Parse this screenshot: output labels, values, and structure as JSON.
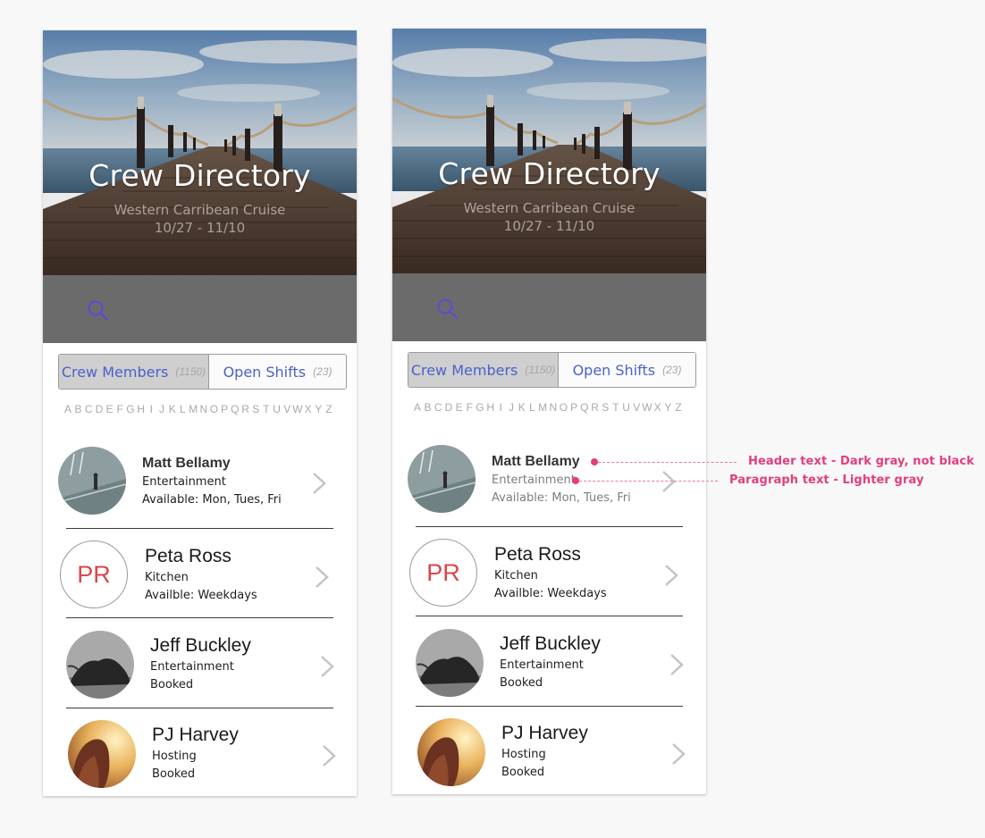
{
  "screens": [
    {
      "hero": {
        "title": "Crew Directory",
        "subtitle": "Western Carribean Cruise",
        "dates": "10/27 - 11/10"
      },
      "tabs": [
        {
          "label": "Crew Members",
          "count": "(1150)"
        },
        {
          "label": "Open Shifts",
          "count": "(23)"
        }
      ],
      "alphabet": [
        "A",
        "B",
        "C",
        "D",
        "E",
        "F",
        "G",
        "H",
        "I",
        "J",
        "K",
        "L",
        "M",
        "N",
        "O",
        "P",
        "Q",
        "R",
        "S",
        "T",
        "U",
        "V",
        "W",
        "X",
        "Y",
        "Z"
      ],
      "crew": [
        {
          "name": "Matt Bellamy",
          "role": "Entertainment",
          "availability": "Available: Mon, Tues, Fri",
          "avatar": "photo-platform"
        },
        {
          "name": "Peta Ross",
          "role": "Kitchen",
          "availability": "Availble: Weekdays",
          "initials": "PR"
        },
        {
          "name": "Jeff Buckley",
          "role": "Entertainment",
          "availability": "Booked",
          "avatar": "photo-hair-bw"
        },
        {
          "name": "PJ Harvey",
          "role": "Hosting",
          "availability": "Booked",
          "avatar": "photo-field-sunset"
        }
      ]
    },
    {
      "hero": {
        "title": "Crew Directory",
        "subtitle": "Western Carribean Cruise",
        "dates": "10/27 - 11/10"
      },
      "tabs": [
        {
          "label": "Crew Members",
          "count": "(1150)"
        },
        {
          "label": "Open Shifts",
          "count": "(23)"
        }
      ],
      "alphabet": [
        "A",
        "B",
        "C",
        "D",
        "E",
        "F",
        "G",
        "H",
        "I",
        "J",
        "K",
        "L",
        "M",
        "N",
        "O",
        "P",
        "Q",
        "R",
        "S",
        "T",
        "U",
        "V",
        "W",
        "X",
        "Y",
        "Z"
      ],
      "crew": [
        {
          "name": "Matt Bellamy",
          "role": "Entertainment",
          "availability": "Available: Mon, Tues, Fri",
          "avatar": "photo-platform"
        },
        {
          "name": "Peta Ross",
          "role": "Kitchen",
          "availability": "Availble: Weekdays",
          "initials": "PR"
        },
        {
          "name": "Jeff Buckley",
          "role": "Entertainment",
          "availability": "Booked",
          "avatar": "photo-hair-bw"
        },
        {
          "name": "PJ Harvey",
          "role": "Hosting",
          "availability": "Booked",
          "avatar": "photo-field-sunset"
        }
      ]
    }
  ],
  "annotations": {
    "header_note": "Header text - Dark gray, not black",
    "paragraph_note": "Paragraph text - Lighter gray",
    "color": "#e33d7e"
  },
  "colors": {
    "tab_text": "#4a62c9",
    "initials": "#d8474b",
    "search_icon": "#5b4ad6",
    "search_bar": "#6b6b6b"
  }
}
